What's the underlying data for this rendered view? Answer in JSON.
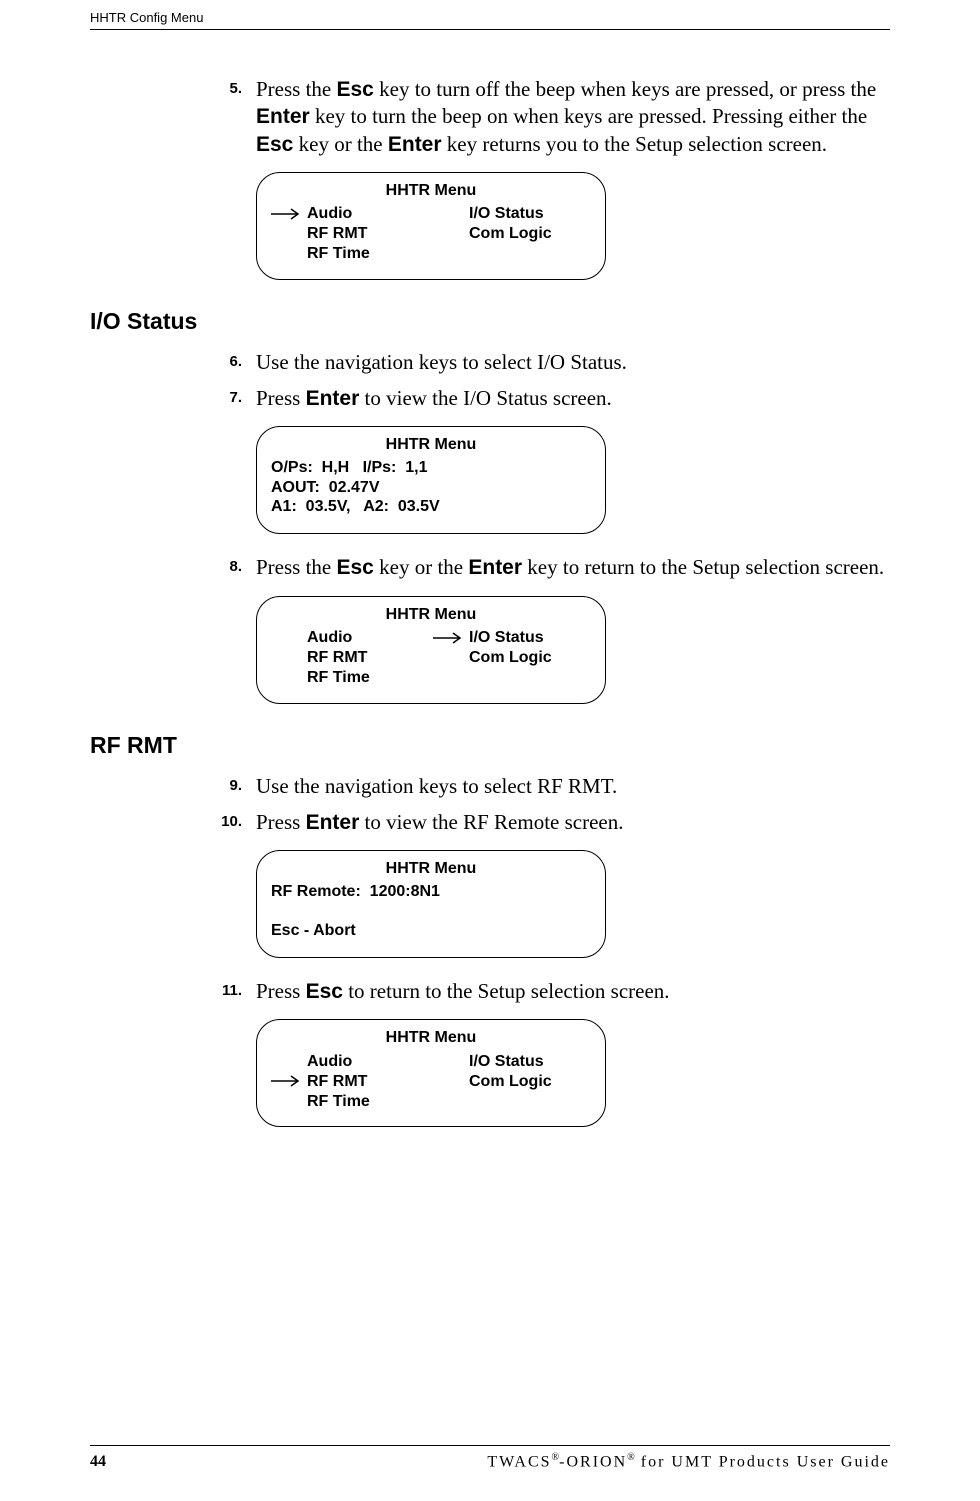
{
  "running_head": "HHTR Config Menu",
  "steps": {
    "s5": {
      "num": "5.",
      "text_parts": [
        "Press the ",
        "Esc",
        " key to turn off the beep when keys are pressed, or press the ",
        "Enter",
        " key to turn the beep on when keys are pressed. Pressing either the ",
        "Esc",
        " key or the ",
        "Enter",
        " key returns you to the Setup selection screen."
      ]
    },
    "s6": {
      "num": "6.",
      "text": "Use the navigation keys to select I/O Status."
    },
    "s7": {
      "num": "7.",
      "text_parts": [
        "Press ",
        "Enter",
        " to view the I/O Status screen."
      ]
    },
    "s8": {
      "num": "8.",
      "text_parts": [
        "Press the ",
        "Esc",
        " key or the ",
        "Enter",
        " key to return to the Setup selection screen."
      ]
    },
    "s9": {
      "num": "9.",
      "text": "Use the navigation keys to select RF RMT."
    },
    "s10": {
      "num": "10.",
      "text_parts": [
        "Press ",
        "Enter",
        " to view the RF Remote screen."
      ]
    },
    "s11": {
      "num": "11.",
      "text_parts": [
        "Press ",
        "Esc",
        " to return to the Setup selection screen."
      ]
    }
  },
  "headings": {
    "h_io": "I/O Status",
    "h_rf": "RF RMT"
  },
  "lcd": {
    "title": "HHTR Menu",
    "menu": {
      "left": [
        "Audio",
        "RF RMT",
        "RF Time"
      ],
      "right": [
        "I/O Status",
        "Com Logic"
      ]
    },
    "io_status": {
      "l1": "O/Ps:  H,H   I/Ps:  1,1",
      "l2": "AOUT:  02.47V",
      "l3": "A1:  03.5V,   A2:  03.5V"
    },
    "rf_remote": {
      "l1": "RF Remote:  1200:8N1",
      "l3": "Esc - Abort"
    }
  },
  "footer": {
    "page": "44",
    "title_parts": [
      "TWACS",
      "®",
      "-ORION",
      "®",
      " for UMT Products User Guide"
    ]
  }
}
